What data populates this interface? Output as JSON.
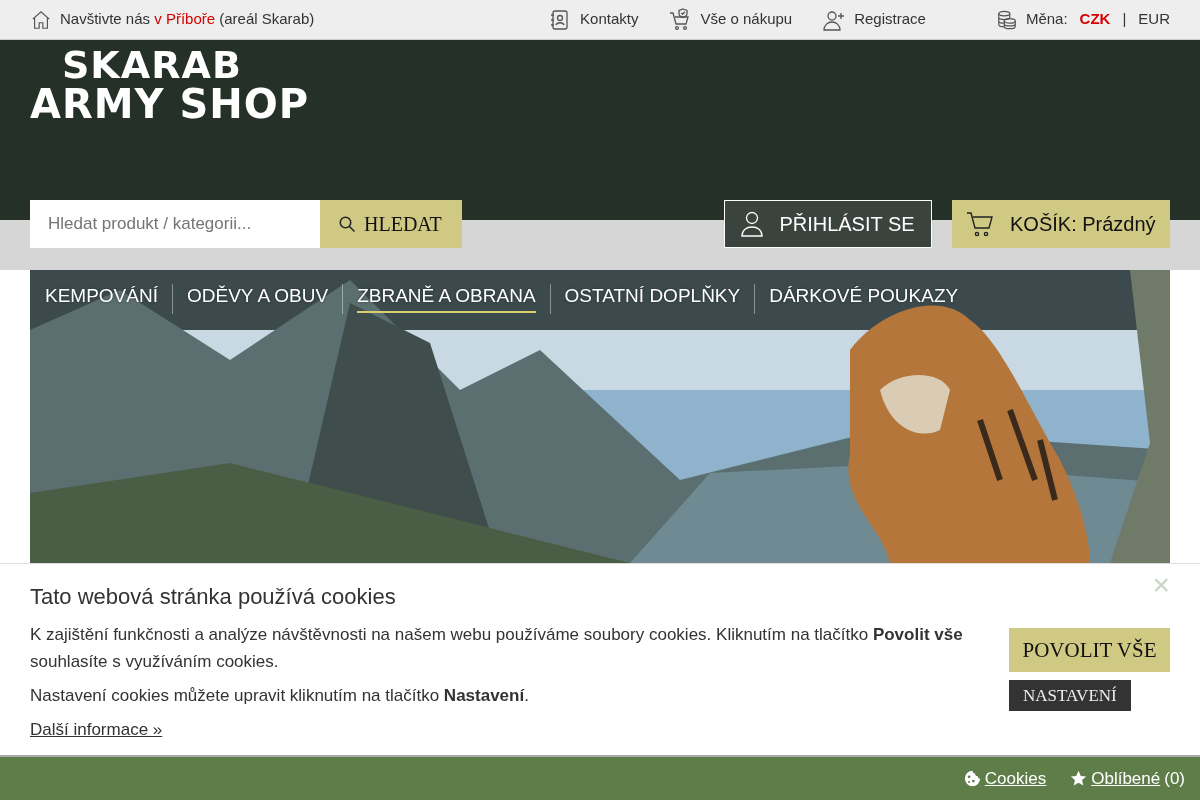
{
  "topbar": {
    "visit": {
      "before": "Navštivte nás",
      "link": "v Příboře",
      "after": "(areál Skarab)"
    },
    "links": [
      {
        "kind": "contacts",
        "label": "Kontakty"
      },
      {
        "kind": "shopping",
        "label": "Vše o nákupu"
      },
      {
        "kind": "register",
        "label": "Registrace"
      }
    ],
    "currency": {
      "label": "Měna:",
      "separator": "|",
      "options": [
        {
          "label": "CZK",
          "selected": true
        },
        {
          "label": "EUR",
          "selected": false
        }
      ]
    }
  },
  "logo": {
    "line1": "SKARAB",
    "line2": "ARMY SHOP"
  },
  "search": {
    "placeholder": "Hledat produkt / kategorii...",
    "button": "HLEDAT"
  },
  "login": "PŘIHLÁSIT SE",
  "cart": {
    "label": "KOŠÍK: Prázdný"
  },
  "nav": [
    {
      "label": "KEMPOVÁNÍ",
      "selected": false
    },
    {
      "label": "ODĚVY A OBUV",
      "selected": false
    },
    {
      "label": "ZBRANĚ A OBRANA",
      "selected": true
    },
    {
      "label": "OSTATNÍ DOPLŇKY",
      "selected": false
    },
    {
      "label": "DÁRKOVÉ POUKAZY",
      "selected": false
    }
  ],
  "cookies": {
    "title": "Tato webová stránka používá cookies",
    "text1": "K zajištění funkčnosti a analýze návštěvnosti na našem webu používáme soubory cookies. Kliknutím na tlačítko **Povolit vše** souhlasíte s využíváním cookies.",
    "text2": "Nastavení cookies můžete upravit kliknutím na tlačítko **Nastavení**.",
    "more": "Další informace »",
    "accept": "POVOLIT VŠE",
    "settings": "NASTAVENÍ",
    "close": "×"
  },
  "footer": {
    "cookies": "Cookies",
    "favorites": "Oblíbené",
    "favorites_count": "(0)"
  }
}
